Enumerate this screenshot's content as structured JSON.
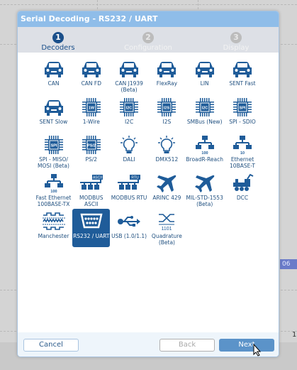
{
  "window": {
    "title": "Serial Decoding - RS232 / UART"
  },
  "steps": [
    {
      "num": "1",
      "label": "Decoders",
      "active": true
    },
    {
      "num": "2",
      "label": "Configuration",
      "active": false
    },
    {
      "num": "3",
      "label": "Display",
      "active": false
    }
  ],
  "decoders": [
    {
      "label": "CAN",
      "icon": "car"
    },
    {
      "label": "CAN FD",
      "icon": "car"
    },
    {
      "label": "CAN J1939 (Beta)",
      "icon": "car"
    },
    {
      "label": "FlexRay",
      "icon": "car"
    },
    {
      "label": "LIN",
      "icon": "car"
    },
    {
      "label": "SENT Fast",
      "icon": "car"
    },
    {
      "label": "SENT Slow",
      "icon": "car"
    },
    {
      "label": "1-Wire",
      "icon": "chip",
      "chip": "1W"
    },
    {
      "label": "I2C",
      "icon": "chip",
      "chip": "I2C"
    },
    {
      "label": "I2S",
      "icon": "chip",
      "chip": "I2S"
    },
    {
      "label": "SMBus (New)",
      "icon": "chip",
      "chip": "I2C"
    },
    {
      "label": "SPI - SDIO",
      "icon": "chip",
      "chip": "SPI"
    },
    {
      "label": "SPI - MISO/ MOSI (Beta)",
      "icon": "chip",
      "chip": "SPI"
    },
    {
      "label": "PS/2",
      "icon": "chip",
      "chip": "PS/2"
    },
    {
      "label": "DALI",
      "icon": "bulb"
    },
    {
      "label": "DMX512",
      "icon": "bulb"
    },
    {
      "label": "BroadR-Reach",
      "icon": "network",
      "tag": "100"
    },
    {
      "label": "Ethernet 10BASE-T",
      "icon": "network",
      "tag": "10"
    },
    {
      "label": "Fast Ethernet 100BASE-TX",
      "icon": "network",
      "tag": "100"
    },
    {
      "label": "MODBUS ASCII",
      "icon": "bus",
      "tag": "ASCII"
    },
    {
      "label": "MODBUS RTU",
      "icon": "bus",
      "tag": "RTU"
    },
    {
      "label": "ARINC 429",
      "icon": "plane"
    },
    {
      "label": "MIL-STD-1553 (Beta)",
      "icon": "plane"
    },
    {
      "label": "DCC",
      "icon": "train"
    },
    {
      "label": "Manchester",
      "icon": "wave"
    },
    {
      "label": "RS232 / UART",
      "icon": "serial",
      "selected": true
    },
    {
      "label": "USB (1.0/1.1)",
      "icon": "usb"
    },
    {
      "label": "Quadrature (Beta)",
      "icon": "quadrature",
      "tag": "1101"
    }
  ],
  "buttons": {
    "cancel": "Cancel",
    "back": "Back",
    "next": "Next"
  },
  "background": {
    "badge": "06",
    "axis_num": "1"
  },
  "colors": {
    "accent": "#1f5c99",
    "title": "#8fbde9"
  }
}
